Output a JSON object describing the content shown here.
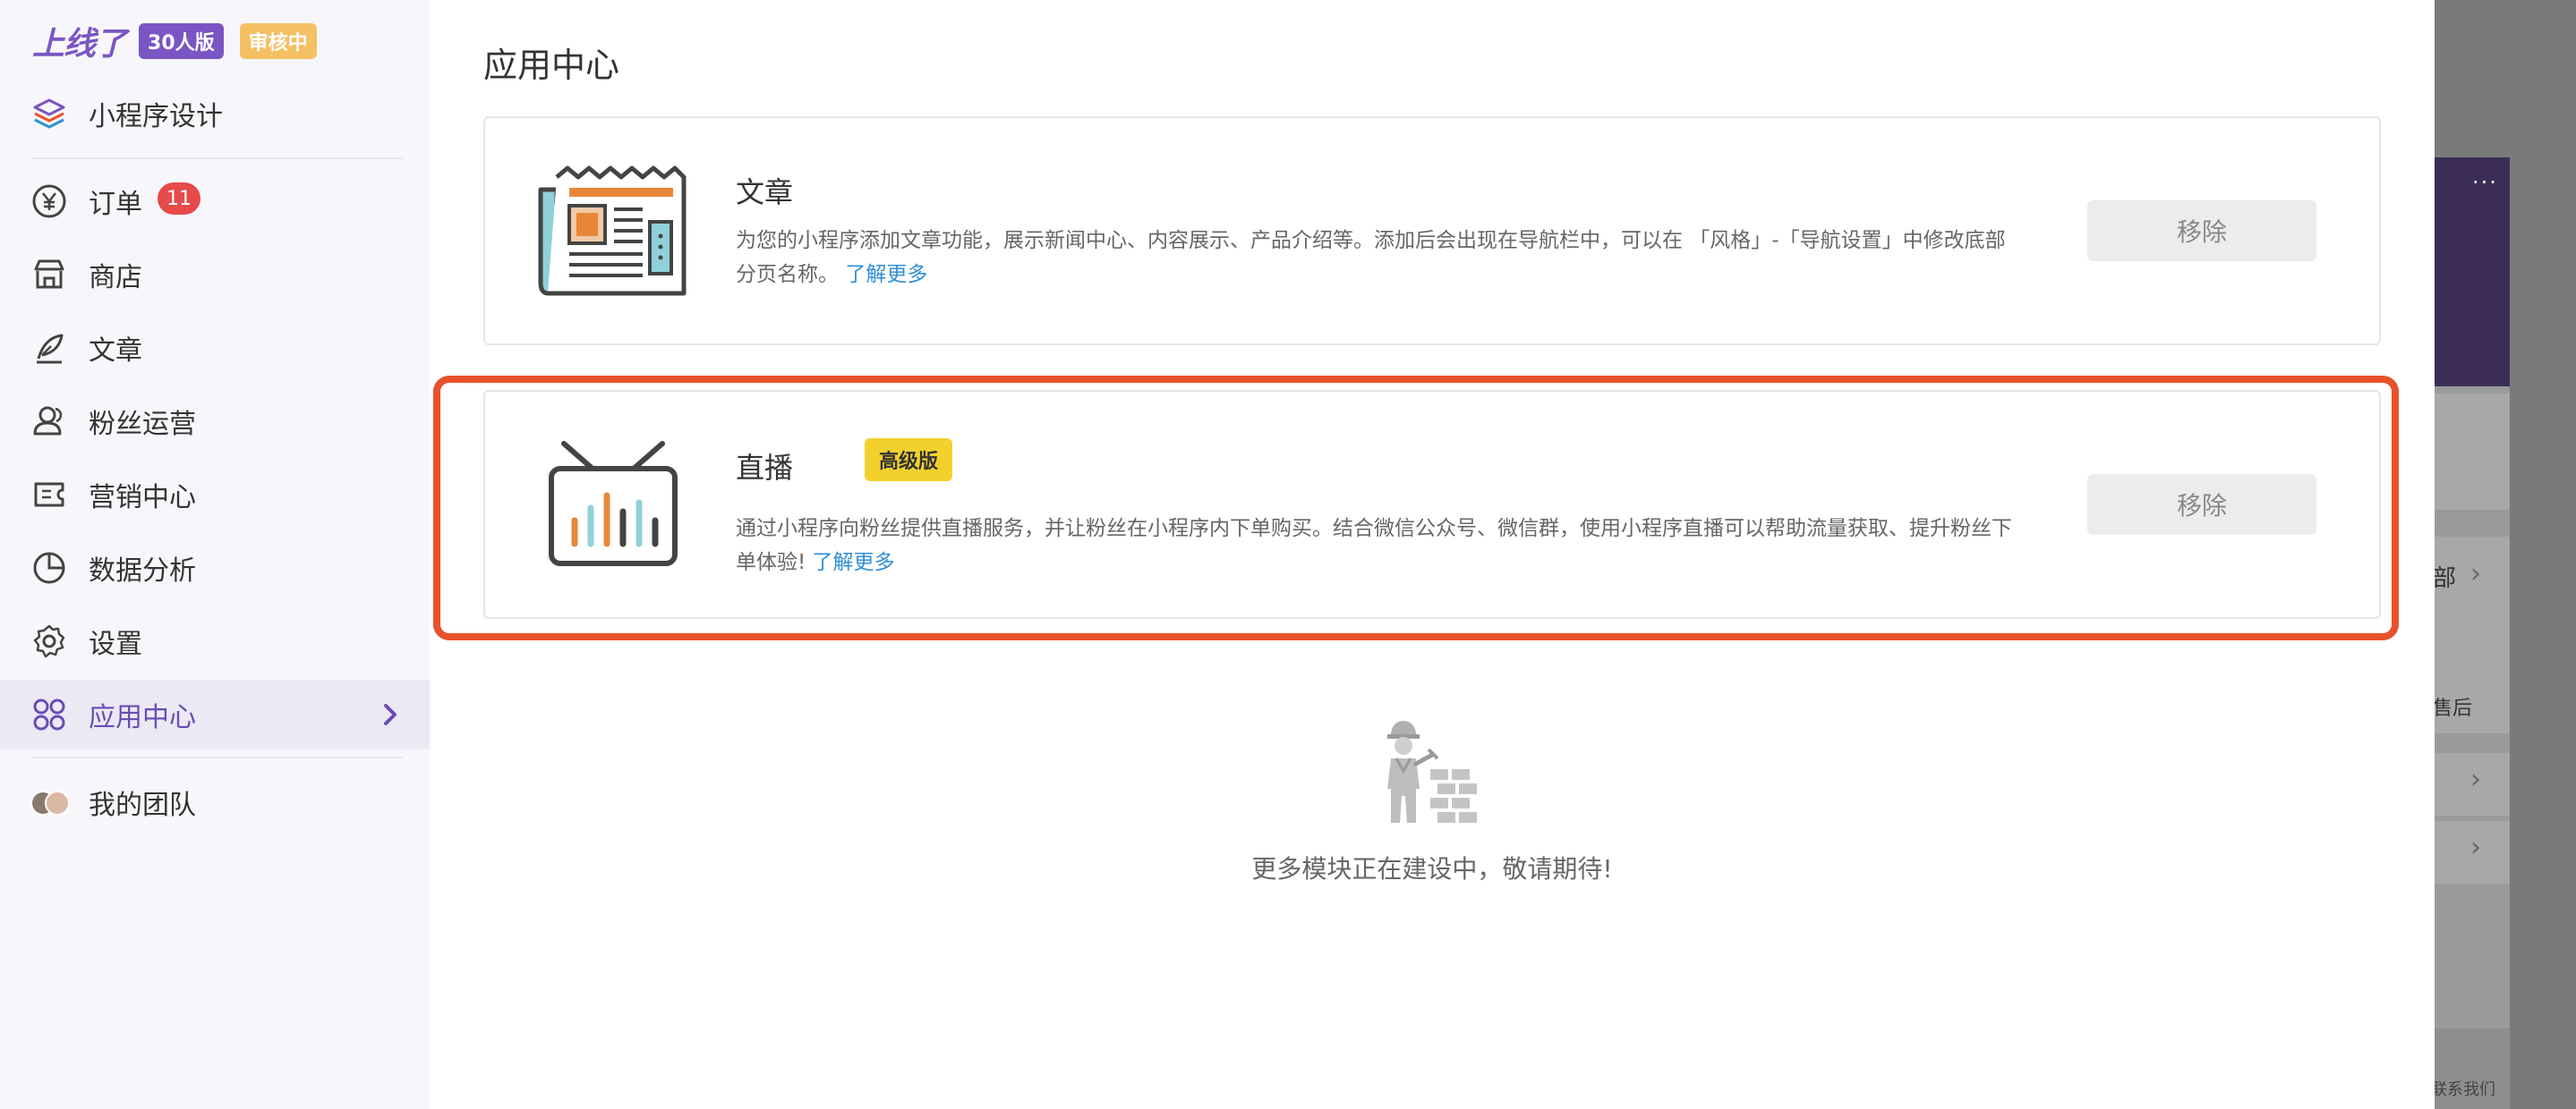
{
  "brand": {
    "logo_text": "上线了",
    "version_badge": "30人版",
    "status_badge": "审核中"
  },
  "sidebar": {
    "items": [
      {
        "label": "小程序设计",
        "icon": "layers-icon"
      },
      {
        "label": "订单",
        "icon": "yen-circle-icon",
        "badge": "11"
      },
      {
        "label": "商店",
        "icon": "store-icon"
      },
      {
        "label": "文章",
        "icon": "feather-pen-icon"
      },
      {
        "label": "粉丝运营",
        "icon": "users-icon"
      },
      {
        "label": "营销中心",
        "icon": "ticket-icon"
      },
      {
        "label": "数据分析",
        "icon": "pie-chart-icon"
      },
      {
        "label": "设置",
        "icon": "gear-icon"
      },
      {
        "label": "应用中心",
        "icon": "apps-grid-icon",
        "active": true
      },
      {
        "label": "我的团队",
        "icon": "team-avatars"
      }
    ]
  },
  "main": {
    "title": "应用中心",
    "apps": [
      {
        "name": "文章",
        "icon": "newspaper-icon",
        "description": "为您的小程序添加文章功能，展示新闻中心、内容展示、产品介绍等。添加后会出现在导航栏中，可以在 「风格」-「导航设置」中修改底部分页名称。",
        "learn_more": "了解更多",
        "action": "移除"
      },
      {
        "name": "直播",
        "icon": "tv-live-icon",
        "tier": "高级版",
        "description": "通过小程序向粉丝提供直播服务，并让粉丝在小程序内下单购买。结合微信公众号、微信群，使用小程序直播可以帮助流量获取、提升粉丝下单体验!",
        "learn_more": "了解更多",
        "action": "移除"
      }
    ],
    "empty_state": {
      "icon": "construction-worker-icon",
      "text": "更多模块正在建设中，敬请期待!"
    }
  },
  "overlay": {
    "dots": "···",
    "text_all": "部",
    "text_after_sale": "售后",
    "text_contact": "联系我们"
  },
  "colors": {
    "brand": "#7a55c3",
    "review_badge": "#f5c064",
    "highlight": "#e8532b",
    "tier_badge": "#f3d12d",
    "link": "#2f8fd8",
    "badge_red": "#e64a4a"
  }
}
